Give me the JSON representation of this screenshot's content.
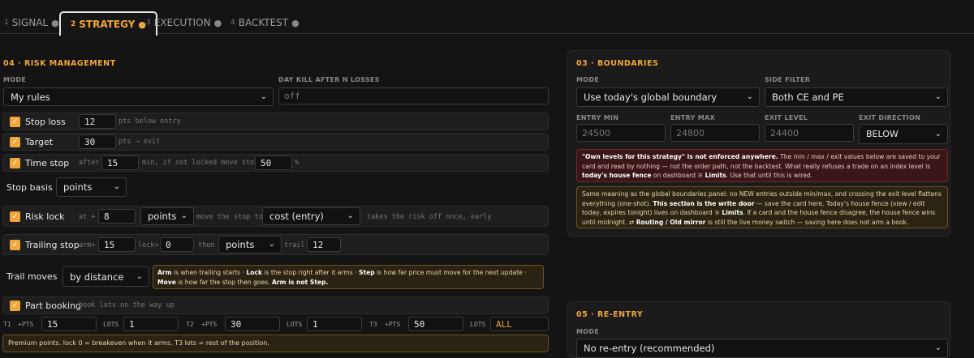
{
  "tabs": [
    {
      "num": "1",
      "label": "SIGNAL",
      "dot": "●"
    },
    {
      "num": "2",
      "label": "STRATEGY",
      "dot": "●"
    },
    {
      "num": "3",
      "label": "EXECUTION",
      "dot": "●"
    },
    {
      "num": "4",
      "label": "BACKTEST",
      "dot": "●"
    }
  ],
  "risk": {
    "title": "04 · RISK MANAGEMENT",
    "mode_label": "MODE",
    "mode_value": "My rules",
    "daykill_label": "DAY KILL AFTER N LOSSES",
    "daykill_placeholder": "off",
    "stop_loss": {
      "label": "Stop loss",
      "value": "12",
      "hint": "pts below entry"
    },
    "target": {
      "label": "Target",
      "value": "30",
      "hint": "pts → exit"
    },
    "time_stop": {
      "label": "Time stop",
      "after": "after",
      "value": "15",
      "hint": "min, if not locked move stop up",
      "value2": "50",
      "unit": "%"
    },
    "stop_basis": {
      "label": "Stop basis",
      "value": "points"
    },
    "risk_lock": {
      "label": "Risk lock",
      "at": "at +",
      "value": "8",
      "unit": "points",
      "move_text": "move the stop to",
      "target": "cost (entry)",
      "hint": "takes the risk off once, early"
    },
    "trailing": {
      "label": "Trailing stop",
      "arm": "arm+",
      "arm_value": "15",
      "lock": "lock+",
      "lock_value": "0",
      "then": "then",
      "unit": "points",
      "trail": "trail",
      "trail_value": "12"
    },
    "trail_moves": {
      "label": "Trail moves",
      "value": "by distance"
    },
    "trail_note": {
      "a": "Arm",
      "a_t": " is when trailing starts · ",
      "b": "Lock",
      "b_t": " is the stop right after it arms · ",
      "c": "Step",
      "c_t": " is how far price must move for the next update · ",
      "d": "Move",
      "d_t": " is how far the stop then goes. ",
      "e": "Arm is not Step."
    },
    "part_booking": {
      "label": "Part booking",
      "hint": "book lots on the way up"
    },
    "t1": {
      "label": "T1",
      "pts": "+PTS",
      "pts_value": "15",
      "lots": "LOTS",
      "lots_value": "1"
    },
    "t2": {
      "label": "T2",
      "pts": "+PTS",
      "pts_value": "30",
      "lots": "LOTS",
      "lots_value": "1"
    },
    "t3": {
      "label": "T3",
      "pts": "+PTS",
      "pts_value": "50",
      "lots": "LOTS",
      "lots_value": "ALL"
    },
    "footer_note": "Premium points. lock 0 = breakeven when it arms. T3 lots = rest of the position."
  },
  "boundaries": {
    "title": "03 · BOUNDARIES",
    "mode_label": "MODE",
    "mode_value": "Use today's global boundary",
    "side_label": "SIDE FILTER",
    "side_value": "Both CE and PE",
    "entry_min_label": "ENTRY MIN",
    "entry_min": "24500",
    "entry_max_label": "ENTRY MAX",
    "entry_max": "24800",
    "exit_level_label": "EXIT LEVEL",
    "exit_level": "24400",
    "exit_dir_label": "EXIT DIRECTION",
    "exit_dir": "BELOW",
    "red_note": {
      "b1": "\"Own levels for this strategy\" is not enforced anywhere.",
      "t1": " The min / max / exit values below are saved to your card and read by nothing — not the order path, not the backtest. What really refuses a trade on an index level is ",
      "b2": "today's house fence",
      "t2": " on dashboard ⚞ ",
      "b3": "Limits",
      "t3": ". Use that until this is wired."
    },
    "yel_note": {
      "t1": "Same meaning as the global boundaries panel: no NEW entries outside min/max, and crossing the exit level flattens everything (one-shot). ",
      "b1": "This section is the write door",
      "t2": " — save the card here. Today's house fence (view / edit today, expires tonight) lives on dashboard ⚞ ",
      "b2": "Limits",
      "t3": ". If a card and the house fence disagree, the house fence wins until midnight. ⇄ ",
      "b3": "Routing / Old mirror",
      "t4": " is still the live money switch — saving here does not arm a book."
    }
  },
  "reentry": {
    "title": "05 · RE-ENTRY",
    "mode_label": "MODE",
    "mode_value": "No re-entry (recommended)"
  },
  "colors": {
    "accent": "#f0a63a",
    "bg": "#141414",
    "panel": "#1b1b1b"
  }
}
